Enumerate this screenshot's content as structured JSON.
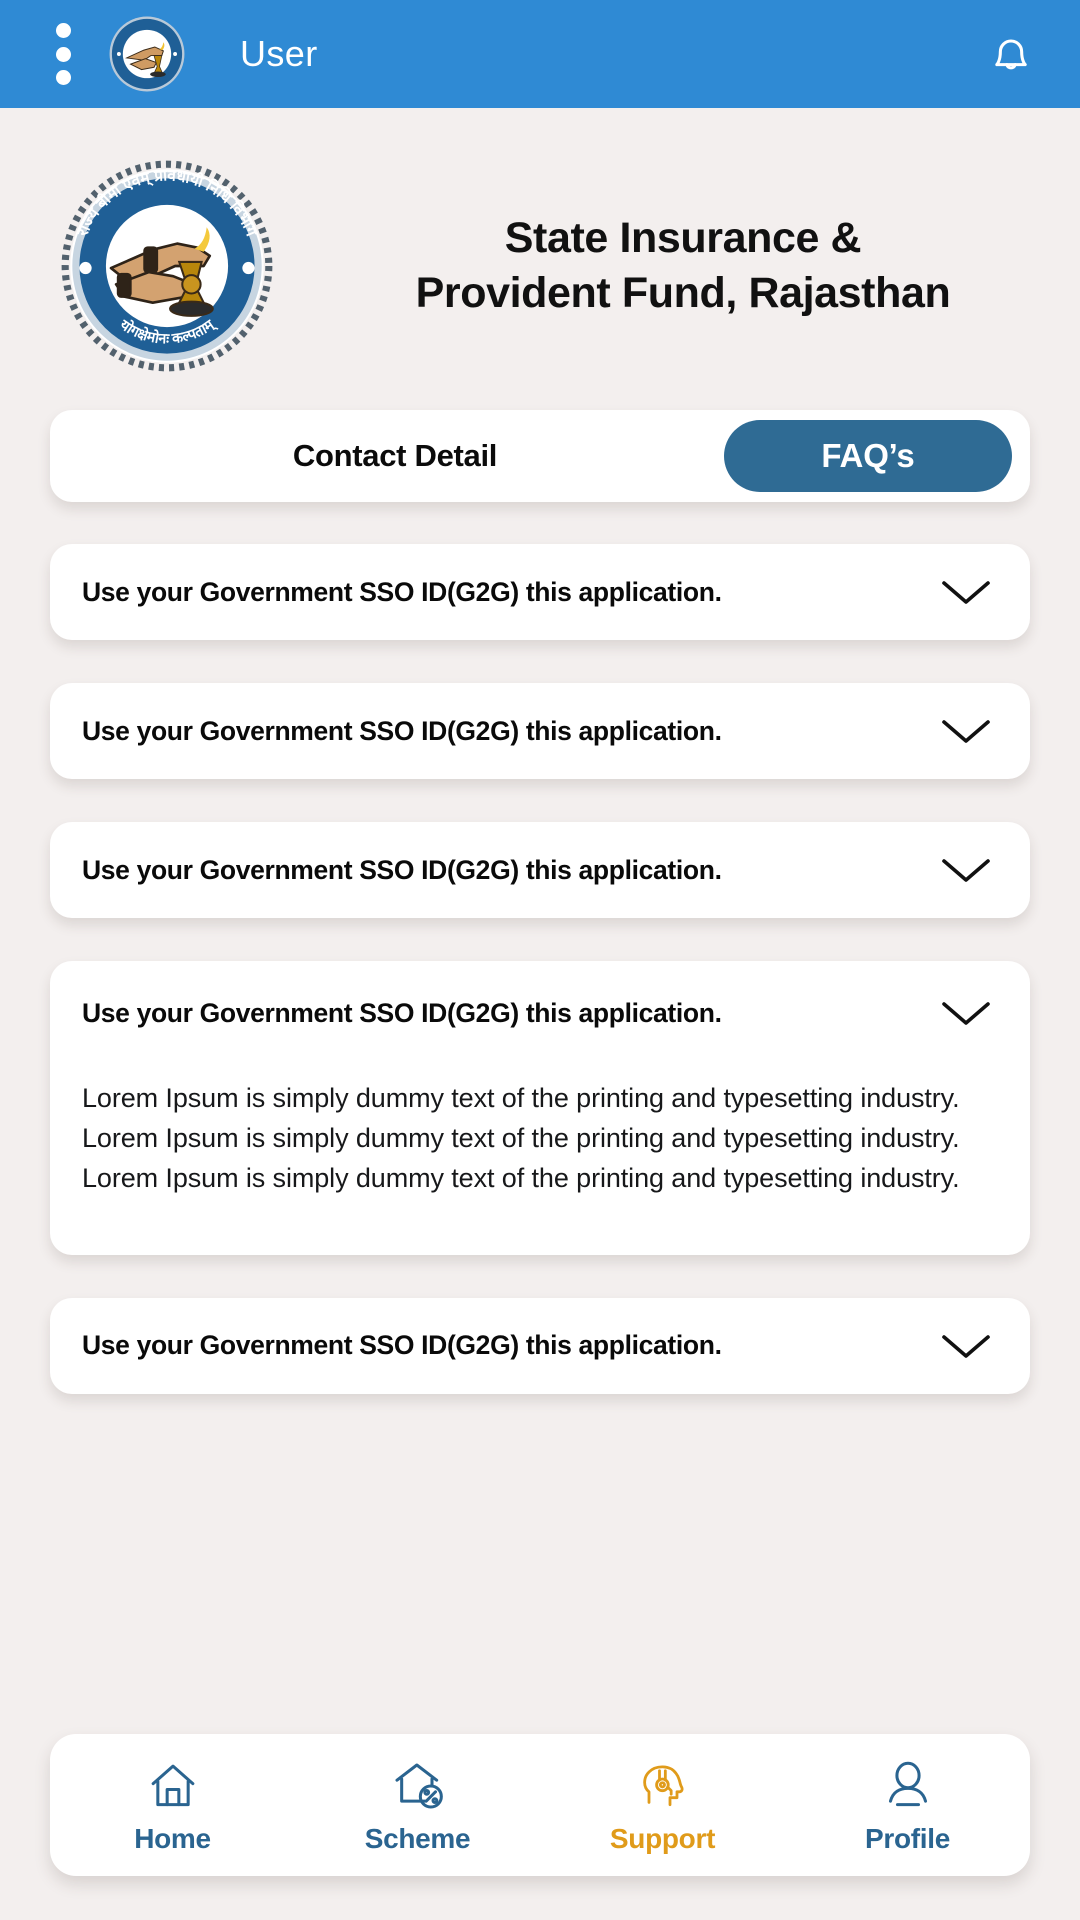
{
  "colors": {
    "header_blue": "#2f8ad4",
    "page_background": "#f3efee",
    "card_white": "#ffffff",
    "tab_active_blue": "#2f6b94",
    "nav_blue": "#2a6490",
    "nav_active_orange": "#e09b1a",
    "text_black": "#0a0a0a"
  },
  "header": {
    "menu_icon": "kebab-menu-icon",
    "emblem_icon": "department-emblem-icon",
    "title": "User",
    "notification_icon": "bell-icon"
  },
  "brand": {
    "emblem_icon": "department-emblem-icon",
    "emblem_text_top": "राज्य बीमा एवम् प्रावधायी निधि विभाग",
    "emblem_text_bottom": "योगक्षेमोनः कल्पताम्",
    "title_line1": "State Insurance &",
    "title_line2": "Provident Fund, Rajasthan"
  },
  "tabs": {
    "contact_label": "Contact Detail",
    "faq_label": "FAQ’s",
    "active": "FAQ’s"
  },
  "faqs": [
    {
      "question": "Use your Government SSO ID(G2G) this application.",
      "expanded": false,
      "answer": "",
      "chevron_icon": "chevron-down-icon"
    },
    {
      "question": "Use your Government SSO ID(G2G) this application.",
      "expanded": false,
      "answer": "",
      "chevron_icon": "chevron-down-icon"
    },
    {
      "question": "Use your Government SSO ID(G2G) this application.",
      "expanded": false,
      "answer": "",
      "chevron_icon": "chevron-down-icon"
    },
    {
      "question": "Use your Government SSO ID(G2G) this application.",
      "expanded": true,
      "answer": "Lorem Ipsum is simply dummy text of the printing and typesetting industry. Lorem Ipsum is simply dummy text of the printing and typesetting industry. Lorem Ipsum is simply dummy text of the printing and typesetting industry.",
      "chevron_icon": "chevron-down-icon"
    },
    {
      "question": "Use your Government SSO ID(G2G) this application.",
      "expanded": false,
      "answer": "",
      "chevron_icon": "chevron-down-icon"
    }
  ],
  "bottom_nav": {
    "items": [
      {
        "label": "Home",
        "icon": "home-icon",
        "active": false
      },
      {
        "label": "Scheme",
        "icon": "house-percent-icon",
        "active": false
      },
      {
        "label": "Support",
        "icon": "headset-support-icon",
        "active": true
      },
      {
        "label": "Profile",
        "icon": "person-icon",
        "active": false
      }
    ]
  }
}
